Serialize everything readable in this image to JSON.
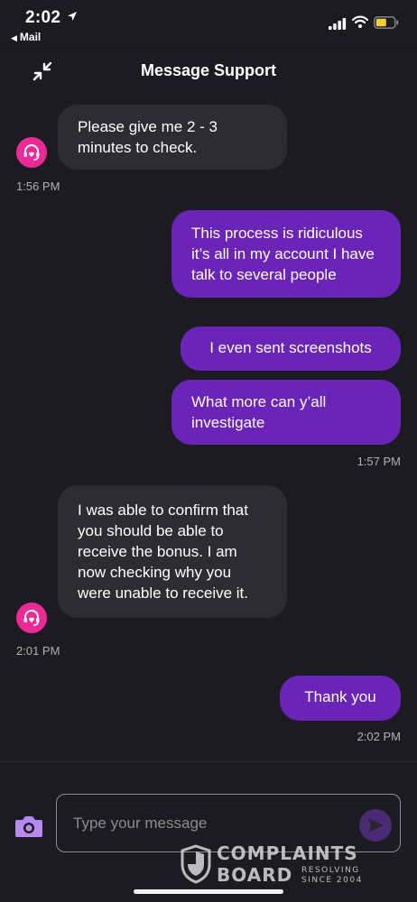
{
  "status_bar": {
    "time": "2:02",
    "back_app": "Mail"
  },
  "header": {
    "title": "Message Support"
  },
  "messages": [
    {
      "sender": "agent",
      "text": "Please give me 2 - 3 minutes to check."
    },
    {
      "sender": "user",
      "text": "This process is ridiculous it’s all in my account I have talk to several people"
    },
    {
      "sender": "user",
      "text": "I even sent screenshots"
    },
    {
      "sender": "user",
      "text": "What more can y’all investigate"
    },
    {
      "sender": "agent",
      "text": "I was able to confirm that you should be able to receive the bonus. I am now checking why you were unable to receive it."
    },
    {
      "sender": "user",
      "text": "Thank you"
    }
  ],
  "timestamps": [
    "1:56 PM",
    "1:57 PM",
    "2:01 PM",
    "2:02 PM"
  ],
  "input": {
    "placeholder": "Type your message",
    "value": ""
  },
  "watermark": {
    "line1": "COMPLAINTS",
    "line2": "BOARD",
    "tag1": "RESOLVING",
    "tag2": "SINCE 2004"
  },
  "colors": {
    "background": "#1c1b21",
    "agent_bubble": "#2d2c33",
    "user_bubble": "#6a25b8",
    "avatar": "#ec2a96",
    "accent": "#b78af0"
  },
  "icons": {
    "status": [
      "location-arrow-icon",
      "back-triangle-icon",
      "signal-icon",
      "wifi-icon",
      "battery-icon"
    ],
    "header": [
      "collapse-icon"
    ],
    "chat": [
      "support-agent-icon"
    ],
    "input": [
      "camera-icon",
      "send-icon"
    ]
  }
}
